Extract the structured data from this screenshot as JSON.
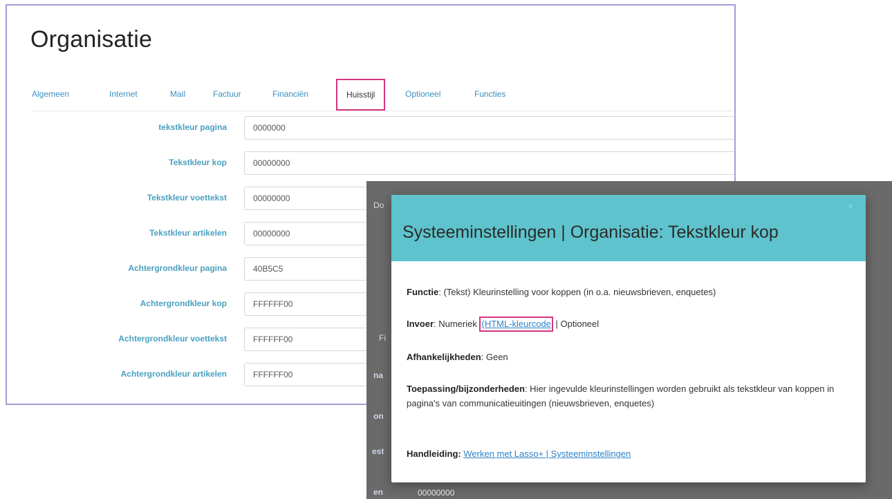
{
  "back": {
    "title": "Organisatie",
    "tabs": [
      "Algemeen",
      "Internet",
      "Mail",
      "Factuur",
      "Financiën",
      "Huisstijl",
      "Optioneel",
      "Functies"
    ],
    "fields": [
      {
        "label": "tekstkleur pagina",
        "value": "0000000"
      },
      {
        "label": "Tekstkleur kop",
        "value": "00000000"
      },
      {
        "label": "Tekstkleur voettekst",
        "value": "00000000"
      },
      {
        "label": "Tekstkleur artikelen",
        "value": "00000000"
      },
      {
        "label": "Achtergrondkleur pagina",
        "value": "40B5C5"
      },
      {
        "label": "Achtergrondkleur kop",
        "value": "FFFFFF00"
      },
      {
        "label": "Achtergrondkleur voettekst",
        "value": "FFFFFF00"
      },
      {
        "label": "Achtergrondkleur artikelen",
        "value": "FFFFFF00"
      }
    ]
  },
  "overlay": {
    "bg_fragments": [
      "Do",
      "Fi",
      "na",
      "on",
      "est",
      "en",
      "00000000"
    ]
  },
  "modal": {
    "title": "Systeeminstellingen | Organisatie: Tekstkleur kop",
    "close": "×",
    "functie_label": "Functie",
    "functie_text": ": (Tekst) Kleurinstelling voor koppen (in o.a. nieuwsbrieven, enquetes)",
    "invoer_label": "Invoer",
    "invoer_text_before": ": Numeriek ",
    "invoer_link": "(HTML-kleurcode",
    "invoer_text_after": " | Optioneel",
    "afhankelijkheden_label": "Afhankelijkheden",
    "afhankelijkheden_text": ": Geen",
    "toepassing_label": "Toepassing/bijzonderheden",
    "toepassing_text": ": Hier ingevulde kleurinstellingen worden gebruikt als tekstkleur van koppen in pagina's van communicatieuitingen (nieuwsbrieven, enquetes)",
    "handleiding_label": "Handleiding:",
    "handleiding_link": "Werken met Lasso+ | Systeeminstellingen"
  },
  "colors": {
    "tab_active_border": "#d6337f",
    "accent_teal": "#5ec3cc",
    "link_blue": "#2d83c9",
    "label_teal": "#4a9fc0",
    "window_border": "#a59bd6"
  }
}
